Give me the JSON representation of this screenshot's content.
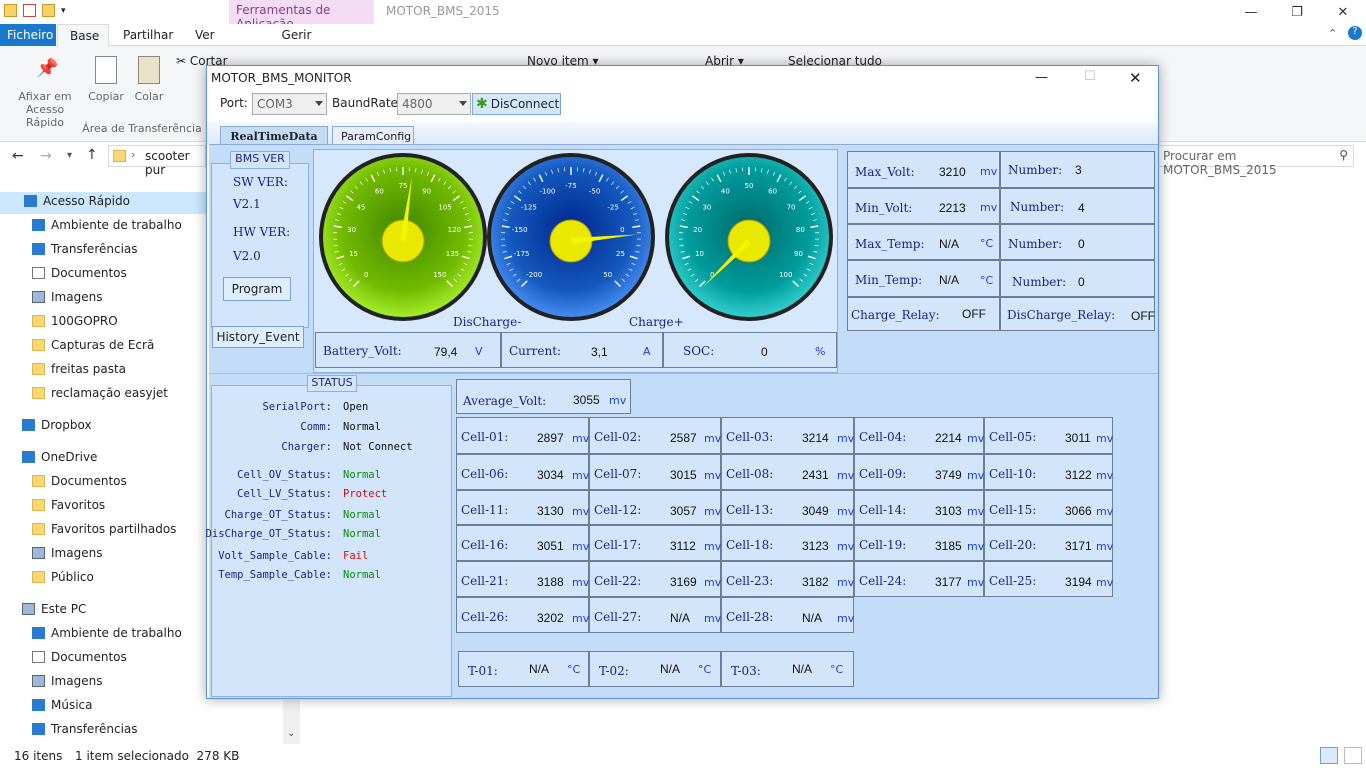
{
  "explorer": {
    "context_tab": "Ferramentas de Aplicação",
    "window_title": "MOTOR_BMS_2015",
    "tabs": [
      "Ficheiro",
      "Base",
      "Partilhar",
      "Ver",
      "Gerir"
    ],
    "ribbon": {
      "pin": "Afixar em Acesso Rápido",
      "copy": "Copiar",
      "paste": "Colar",
      "cut": "Cortar",
      "new_item": "Novo item",
      "open": "Abrir",
      "select_all": "Selecionar tudo",
      "group_clipboard": "Área de Transferência"
    },
    "address": "scooter pur",
    "search_placeholder": "Procurar em MOTOR_BMS_2015",
    "nav": [
      {
        "label": "Acesso Rápido",
        "icon": "star-icon"
      },
      {
        "label": "Ambiente de trabalho",
        "icon": "desktop-icon"
      },
      {
        "label": "Transferências",
        "icon": "download-icon"
      },
      {
        "label": "Documentos",
        "icon": "documents-icon"
      },
      {
        "label": "Imagens",
        "icon": "pictures-icon"
      },
      {
        "label": "100GOPRO",
        "icon": "folder-icon"
      },
      {
        "label": "Capturas de Ecrã",
        "icon": "folder-icon"
      },
      {
        "label": "freitas pasta",
        "icon": "folder-icon"
      },
      {
        "label": "reclamação easyjet",
        "icon": "folder-icon"
      },
      {
        "label": "Dropbox",
        "icon": "dropbox-icon"
      },
      {
        "label": "OneDrive",
        "icon": "onedrive-icon"
      },
      {
        "label": "Documentos",
        "icon": "folder-icon"
      },
      {
        "label": "Favoritos",
        "icon": "folder-icon"
      },
      {
        "label": "Favoritos partilhados",
        "icon": "folder-icon"
      },
      {
        "label": "Imagens",
        "icon": "pictures-icon"
      },
      {
        "label": "Público",
        "icon": "folder-icon"
      },
      {
        "label": "Este PC",
        "icon": "pc-icon"
      },
      {
        "label": "Ambiente de trabalho",
        "icon": "desktop-icon"
      },
      {
        "label": "Documentos",
        "icon": "documents-icon"
      },
      {
        "label": "Imagens",
        "icon": "pictures-icon"
      },
      {
        "label": "Música",
        "icon": "music-icon"
      },
      {
        "label": "Transferências",
        "icon": "download-icon"
      }
    ],
    "status_items": "16 itens",
    "status_selected": "1 item selecionado  278 KB"
  },
  "bms": {
    "title": "MOTOR_BMS_MONITOR",
    "port_label": "Port:",
    "port_value": "COM3",
    "baud_label": "BaundRate:",
    "baud_value": "4800",
    "connect_button": "DisConnect",
    "tabs": [
      "RealTimeData",
      "ParamConfig"
    ],
    "bms_ver_title": "BMS VER",
    "sw_ver_label": "SW VER:",
    "sw_ver": "V2.1",
    "hw_ver_label": "HW VER:",
    "hw_ver": "V2.0",
    "program_button": "Program",
    "history_button": "History_Event",
    "gauges": [
      {
        "name": "voltage",
        "ticks": [
          "0",
          "15",
          "30",
          "45",
          "60",
          "75",
          "90",
          "105",
          "120",
          "135",
          "150"
        ],
        "needle_value": 79.4,
        "min": 0,
        "max": 150,
        "color": "#7cc400"
      },
      {
        "name": "current",
        "ticks": [
          "-200",
          "-175",
          "-150",
          "-125",
          "-100",
          "-75",
          "-50",
          "-25",
          "0",
          "25",
          "50"
        ],
        "needle_value": 3.1,
        "min": -200,
        "max": 50,
        "color": "#1e63c8"
      },
      {
        "name": "soc",
        "ticks": [
          "0",
          "10",
          "20",
          "30",
          "40",
          "50",
          "60",
          "70",
          "80",
          "90",
          "100"
        ],
        "needle_value": 0,
        "min": 0,
        "max": 100,
        "color": "#0aa6a6"
      }
    ],
    "gauge_discharge_label": "DisCharge-",
    "gauge_charge_label": "Charge+",
    "battery_volt_label": "Battery_Volt:",
    "battery_volt": "79,4",
    "battery_volt_unit": "V",
    "current_label": "Current:",
    "current": "3,1",
    "current_unit": "A",
    "soc_label": "SOC:",
    "soc": "0",
    "soc_unit": "%",
    "max_volt_label": "Max_Volt:",
    "max_volt": "3210",
    "min_volt_label": "Min_Volt:",
    "min_volt": "2213",
    "max_temp_label": "Max_Temp:",
    "max_temp": "N/A",
    "min_temp_label": "Min_Temp:",
    "min_temp": "N/A",
    "mv": "mv",
    "degc": "°C",
    "number_label": "Number:",
    "max_volt_number": "3",
    "min_volt_number": "4",
    "max_temp_number": "0",
    "min_temp_number": "0",
    "charge_relay_label": "Charge_Relay:",
    "charge_relay": "OFF",
    "discharge_relay_label": "DisCharge_Relay:",
    "discharge_relay": "OFF",
    "status_title": "STATUS",
    "status": [
      {
        "label": "SerialPort:",
        "value": "Open",
        "color": "#111111"
      },
      {
        "label": "Comm:",
        "value": "Normal",
        "color": "#111111"
      },
      {
        "label": "Charger:",
        "value": "Not Connect",
        "color": "#111111"
      },
      {
        "label": "Cell_OV_Status:",
        "value": "Normal",
        "color": "#0a8a0a"
      },
      {
        "label": "Cell_LV_Status:",
        "value": "Protect",
        "color": "#d01010"
      },
      {
        "label": "Charge_OT_Status:",
        "value": "Normal",
        "color": "#0a8a0a"
      },
      {
        "label": "DisCharge_OT_Status:",
        "value": "Normal",
        "color": "#0a8a0a"
      },
      {
        "label": "Volt_Sample_Cable:",
        "value": "Fail",
        "color": "#d01010"
      },
      {
        "label": "Temp_Sample_Cable:",
        "value": "Normal",
        "color": "#0a8a0a"
      }
    ],
    "average_volt_label": "Average_Volt:",
    "average_volt": "3055",
    "cells": [
      {
        "label": "Cell-01:",
        "value": "2897"
      },
      {
        "label": "Cell-02:",
        "value": "2587"
      },
      {
        "label": "Cell-03:",
        "value": "3214"
      },
      {
        "label": "Cell-04:",
        "value": "2214"
      },
      {
        "label": "Cell-05:",
        "value": "3011"
      },
      {
        "label": "Cell-06:",
        "value": "3034"
      },
      {
        "label": "Cell-07:",
        "value": "3015"
      },
      {
        "label": "Cell-08:",
        "value": "2431"
      },
      {
        "label": "Cell-09:",
        "value": "3749"
      },
      {
        "label": "Cell-10:",
        "value": "3122"
      },
      {
        "label": "Cell-11:",
        "value": "3130"
      },
      {
        "label": "Cell-12:",
        "value": "3057"
      },
      {
        "label": "Cell-13:",
        "value": "3049"
      },
      {
        "label": "Cell-14:",
        "value": "3103"
      },
      {
        "label": "Cell-15:",
        "value": "3066"
      },
      {
        "label": "Cell-16:",
        "value": "3051"
      },
      {
        "label": "Cell-17:",
        "value": "3112"
      },
      {
        "label": "Cell-18:",
        "value": "3123"
      },
      {
        "label": "Cell-19:",
        "value": "3185"
      },
      {
        "label": "Cell-20:",
        "value": "3171"
      },
      {
        "label": "Cell-21:",
        "value": "3188"
      },
      {
        "label": "Cell-22:",
        "value": "3169"
      },
      {
        "label": "Cell-23:",
        "value": "3182"
      },
      {
        "label": "Cell-24:",
        "value": "3177"
      },
      {
        "label": "Cell-25:",
        "value": "3194"
      },
      {
        "label": "Cell-26:",
        "value": "3202"
      },
      {
        "label": "Cell-27:",
        "value": "N/A"
      },
      {
        "label": "Cell-28:",
        "value": "N/A"
      }
    ],
    "temps": [
      {
        "label": "T-01:",
        "value": "N/A"
      },
      {
        "label": "T-02:",
        "value": "N/A"
      },
      {
        "label": "T-03:",
        "value": "N/A"
      }
    ]
  }
}
